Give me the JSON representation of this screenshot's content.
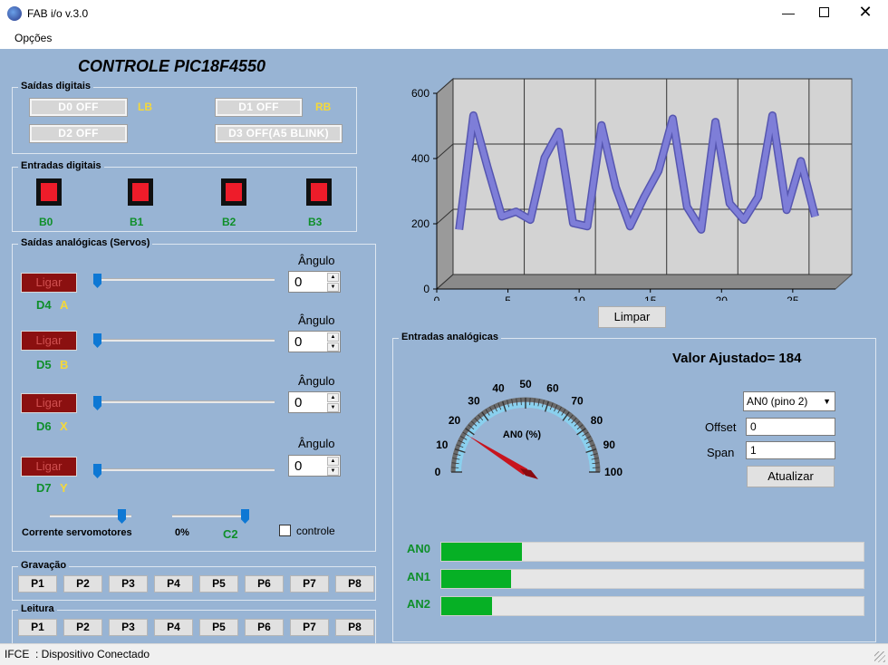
{
  "window": {
    "title": "FAB i/o v.3.0"
  },
  "menu": {
    "options": "Opções"
  },
  "header": {
    "title": "CONTROLE PIC18F4550"
  },
  "digital_outputs": {
    "title": "Saídas digitais",
    "buttons": [
      {
        "label": "D0 OFF",
        "tag": "LB"
      },
      {
        "label": "D1 OFF",
        "tag": "RB"
      },
      {
        "label": "D2 OFF",
        "tag": ""
      },
      {
        "label": "D3 OFF(A5 BLINK)",
        "tag": ""
      }
    ]
  },
  "digital_inputs": {
    "title": "Entradas digitais",
    "leds": [
      {
        "label": "B0"
      },
      {
        "label": "B1"
      },
      {
        "label": "B2"
      },
      {
        "label": "B3"
      }
    ]
  },
  "servos": {
    "title": "Saídas analógicas (Servos)",
    "angle_label": "Ângulo",
    "ligar_label": "Ligar",
    "rows": [
      {
        "pin": "D4",
        "key": "A",
        "angle": "0",
        "slider_value": 0
      },
      {
        "pin": "D5",
        "key": "B",
        "angle": "0",
        "slider_value": 0
      },
      {
        "pin": "D6",
        "key": "X",
        "angle": "0",
        "slider_value": 0
      },
      {
        "pin": "D7",
        "key": "Y",
        "angle": "0",
        "slider_value": 0
      }
    ],
    "current_label": "Corrente servomotores",
    "percent_label": "0%",
    "c2_label": "C2",
    "controle_label": "controle",
    "controle_checked": false
  },
  "gravacao": {
    "title": "Gravação",
    "buttons": [
      "P1",
      "P2",
      "P3",
      "P4",
      "P5",
      "P6",
      "P7",
      "P8"
    ]
  },
  "leitura": {
    "title": "Leitura",
    "buttons": [
      "P1",
      "P2",
      "P3",
      "P4",
      "P5",
      "P6",
      "P7",
      "P8"
    ]
  },
  "chart_data": {
    "type": "line",
    "xlabel": "",
    "ylabel": "",
    "xlim": [
      0,
      28
    ],
    "ylim": [
      0,
      600
    ],
    "x_ticks": [
      "0",
      "5",
      "10",
      "15",
      "20",
      "25"
    ],
    "y_ticks": [
      "0",
      "200",
      "400",
      "600"
    ],
    "grid": true,
    "color": "#7e7ed8",
    "series": [
      {
        "values": [
          [
            1,
            160
          ],
          [
            2,
            510
          ],
          [
            3,
            350
          ],
          [
            4,
            200
          ],
          [
            5,
            215
          ],
          [
            6,
            190
          ],
          [
            7,
            380
          ],
          [
            8,
            460
          ],
          [
            9,
            180
          ],
          [
            10,
            170
          ],
          [
            11,
            480
          ],
          [
            12,
            290
          ],
          [
            13,
            170
          ],
          [
            14,
            260
          ],
          [
            15,
            340
          ],
          [
            16,
            500
          ],
          [
            17,
            230
          ],
          [
            18,
            160
          ],
          [
            19,
            490
          ],
          [
            20,
            240
          ],
          [
            21,
            190
          ],
          [
            22,
            260
          ],
          [
            23,
            510
          ],
          [
            24,
            220
          ],
          [
            25,
            370
          ],
          [
            26,
            200
          ]
        ]
      }
    ]
  },
  "limpar_label": "Limpar",
  "analog_inputs": {
    "title": "Entradas analógicas",
    "valor_ajustado": "Valor Ajustado= 184",
    "gauge": {
      "label": "AN0 (%)",
      "value": 18,
      "ticks": [
        "0",
        "10",
        "20",
        "30",
        "40",
        "50",
        "60",
        "70",
        "80",
        "90",
        "100"
      ]
    },
    "channel_select": "AN0 (pino 2)",
    "offset_label": "Offset",
    "offset_value": "0",
    "span_label": "Span",
    "span_value": "1",
    "update_label": "Atualizar",
    "bars": [
      {
        "label": "AN0",
        "value": 0.19
      },
      {
        "label": "AN1",
        "value": 0.165
      },
      {
        "label": "AN2",
        "value": 0.12
      }
    ]
  },
  "status": {
    "text": "IFCE  : Dispositivo Conectado"
  }
}
